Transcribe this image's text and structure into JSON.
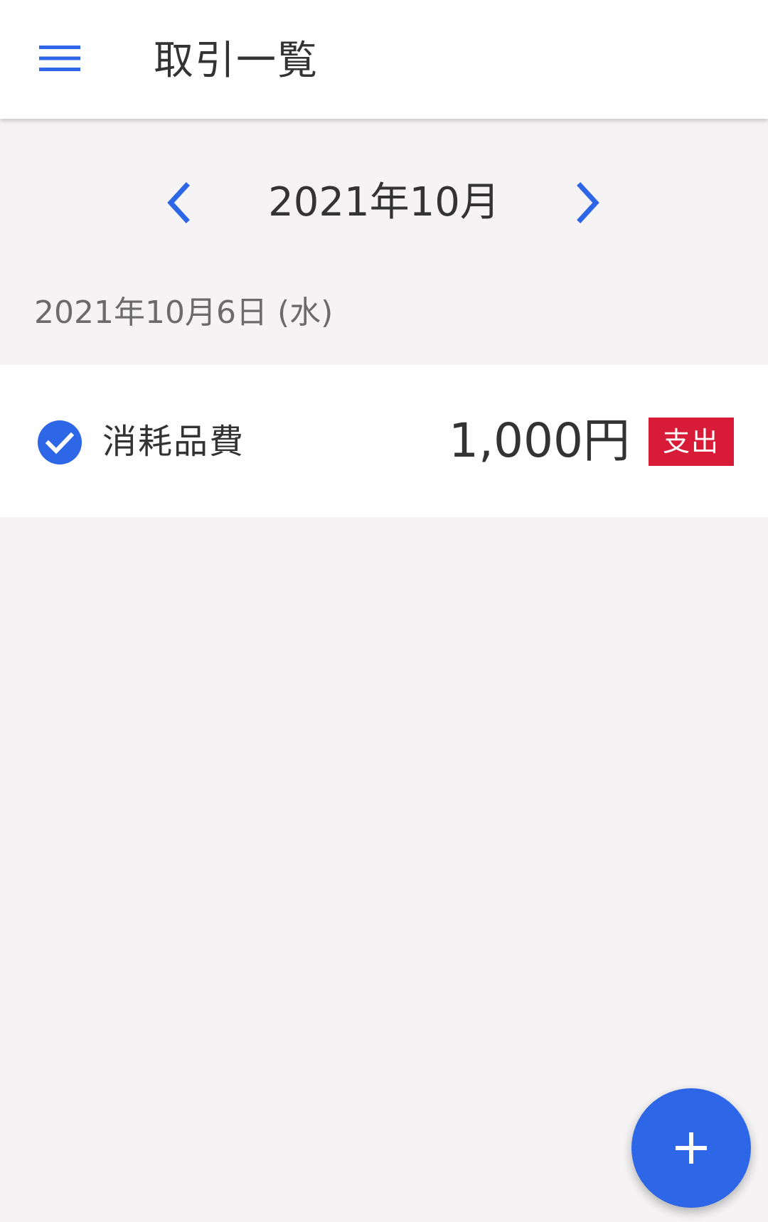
{
  "app_bar": {
    "title": "取引一覧",
    "menu_icon": "menu-icon"
  },
  "month_nav": {
    "label": "2021年10月",
    "prev_icon": "chevron-left-icon",
    "next_icon": "chevron-right-icon"
  },
  "days": [
    {
      "date_label": "2021年10月6日 (水)",
      "transactions": [
        {
          "status_icon": "check-circle-icon",
          "category": "消耗品費",
          "amount": "1,000円",
          "type_badge": "支出"
        }
      ]
    }
  ],
  "fab": {
    "icon": "plus-icon"
  },
  "colors": {
    "accent": "#2d66e6",
    "expense_badge": "#d81b36",
    "background": "#f5f3f4",
    "surface": "#ffffff",
    "text_primary": "#333333",
    "text_secondary": "#6b6b6b"
  }
}
